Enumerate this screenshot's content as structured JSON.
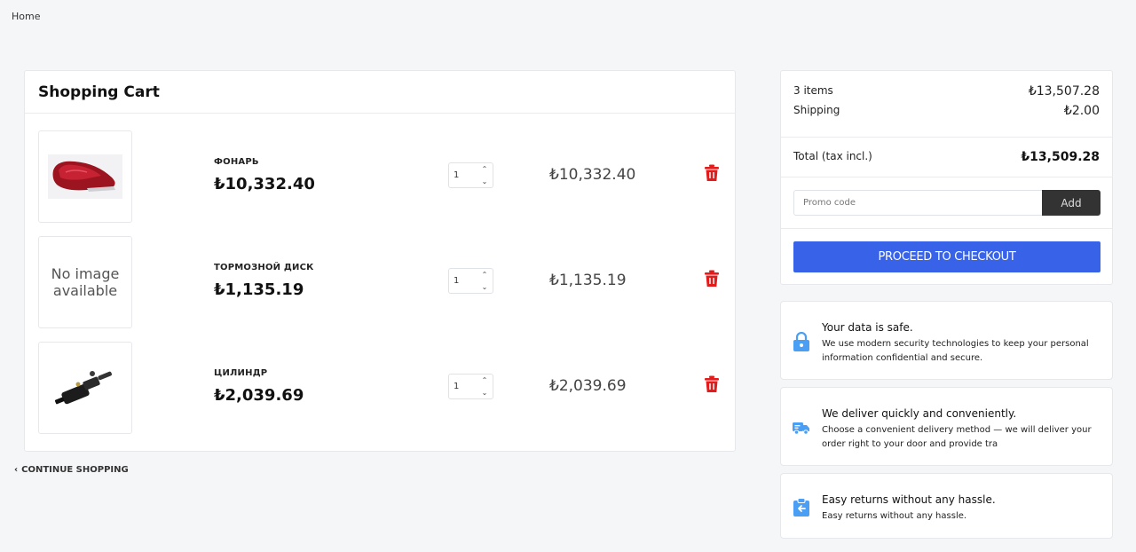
{
  "breadcrumb": {
    "home": "Home"
  },
  "cart": {
    "title": "Shopping Cart",
    "items": [
      {
        "name": "ФОНАРЬ",
        "price": "₺10,332.40",
        "qty": "1",
        "total": "₺10,332.40",
        "image": "tail-light"
      },
      {
        "name": "ТОРМОЗНОЙ ДИСК",
        "price": "₺1,135.19",
        "qty": "1",
        "total": "₺1,135.19",
        "image": "none",
        "no_image_text": "No image available"
      },
      {
        "name": "ЦИЛИНДР",
        "price": "₺2,039.69",
        "qty": "1",
        "total": "₺2,039.69",
        "image": "cylinder"
      }
    ],
    "continue_label": "CONTINUE SHOPPING"
  },
  "summary": {
    "items_label": "3 items",
    "items_value": "₺13,507.28",
    "shipping_label": "Shipping",
    "shipping_value": "₺2.00",
    "total_label": "Total (tax incl.)",
    "total_value": "₺13,509.28",
    "promo_placeholder": "Promo code",
    "promo_add": "Add",
    "checkout_label": "PROCEED TO CHECKOUT"
  },
  "info": [
    {
      "title": "Your data is safe.",
      "desc": "We use modern security technologies to keep your personal information confidential and secure.",
      "icon": "lock-icon"
    },
    {
      "title": "We deliver quickly and conveniently.",
      "desc": "Choose a convenient delivery method — we will deliver your order right to your door and provide tra",
      "icon": "truck-icon"
    },
    {
      "title": "Easy returns without any hassle.",
      "desc": "Easy returns without any hassle.",
      "icon": "return-icon"
    }
  ],
  "colors": {
    "accent": "#3863e8",
    "danger": "#e31b1b",
    "icon_blue": "#4a9ff5",
    "dark_button": "#333333"
  }
}
